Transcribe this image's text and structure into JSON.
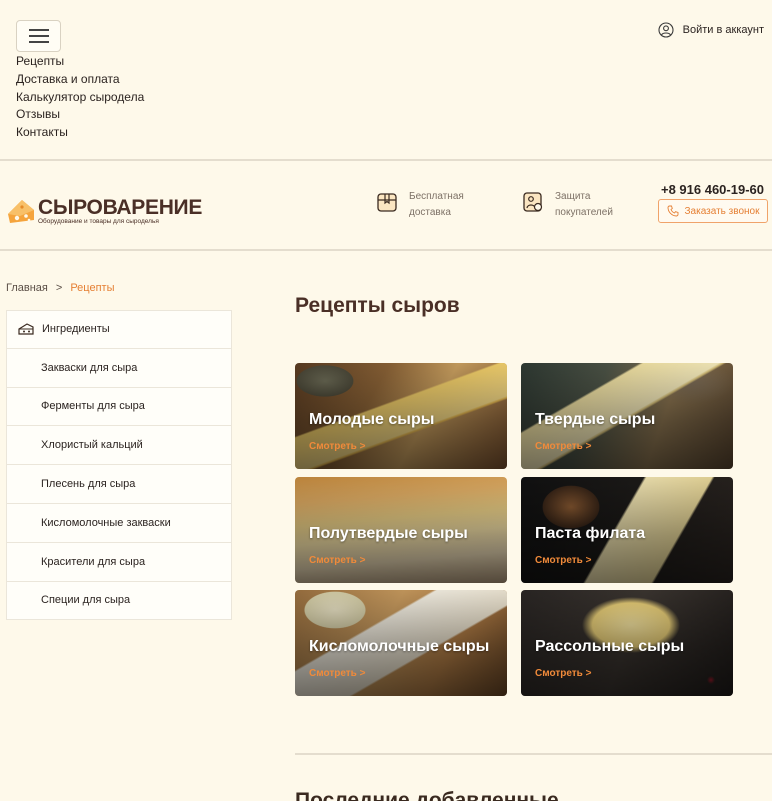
{
  "nav": {
    "items": [
      "Рецепты",
      "Доставка и оплата",
      "Калькулятор сыродела",
      "Отзывы",
      "Контакты"
    ],
    "account_label": "Войти в аккаунт"
  },
  "header": {
    "brand_name": "СЫРОВАРЕНИЕ",
    "brand_tagline": "Оборудование и товары для сыроделья",
    "features": [
      {
        "line1": "Бесплатная",
        "line2": "доставка",
        "icon": "box-icon"
      },
      {
        "line1": "Защита",
        "line2": "покупателей",
        "icon": "shield-badge-icon"
      }
    ],
    "phone": "+8 916 460-19-60",
    "call_button": "Заказать звонок"
  },
  "breadcrumb": {
    "home": "Главная",
    "separator": ">",
    "current": "Рецепты"
  },
  "sidebar": {
    "heading": "Ингредиенты",
    "items": [
      "Закваски для сыра",
      "Ферменты для сыра",
      "Хлористый кальций",
      "Плесень для сыра",
      "Кисломолочные закваски",
      "Красители для сыра",
      "Специи для сыра"
    ]
  },
  "main": {
    "title": "Рецепты сыров",
    "cards": [
      {
        "title": "Молодые сыры",
        "link": "Смотреть >"
      },
      {
        "title": "Твердые сыры",
        "link": "Смотреть >"
      },
      {
        "title": "Полутвердые сыры",
        "link": "Смотреть >"
      },
      {
        "title": "Паста филата",
        "link": "Смотреть >"
      },
      {
        "title": "Кисломолочные сыры",
        "link": "Смотреть >"
      },
      {
        "title": "Рассольные сыры",
        "link": "Смотреть >"
      }
    ],
    "next_section_title": "Последние добавленные"
  },
  "colors": {
    "accent": "#e57f33",
    "brand": "#4a2f26",
    "background": "#fef9ea"
  }
}
